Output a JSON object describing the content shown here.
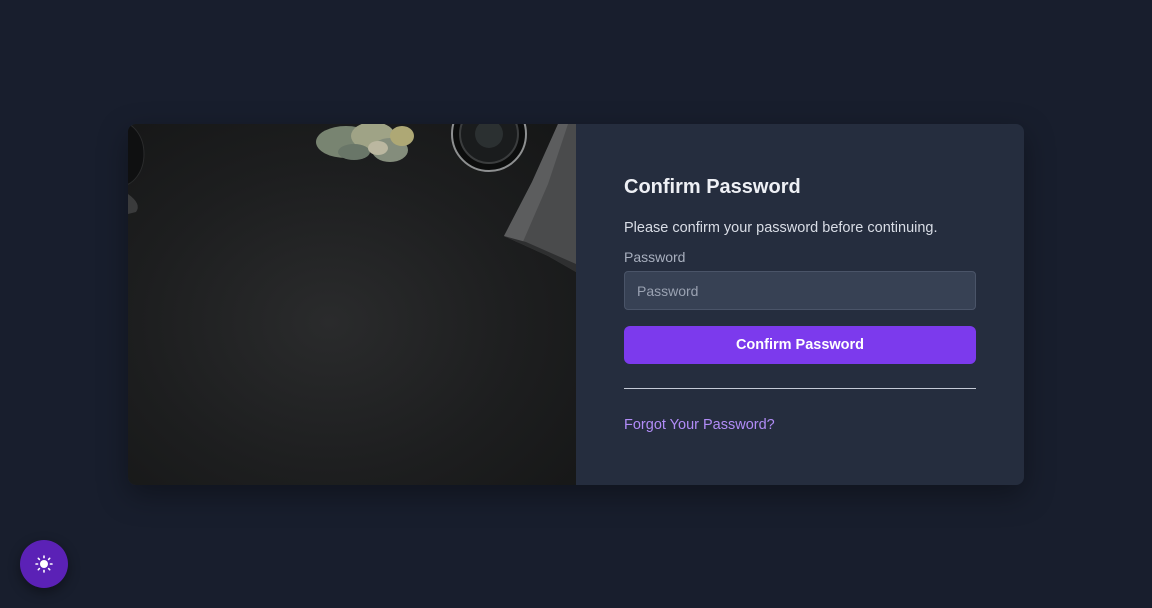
{
  "form": {
    "title": "Confirm Password",
    "description": "Please confirm your password before continuing.",
    "password_label": "Password",
    "password_placeholder": "Password",
    "password_value": "",
    "submit_label": "Confirm Password",
    "forgot_link": "Forgot Your Password?"
  },
  "theme_toggle": {
    "icon": "sun-icon"
  },
  "colors": {
    "background": "#181e2d",
    "card": "#252d3e",
    "accent": "#7c3aed",
    "link": "#b18cf7",
    "toggle": "#5b21b6"
  }
}
